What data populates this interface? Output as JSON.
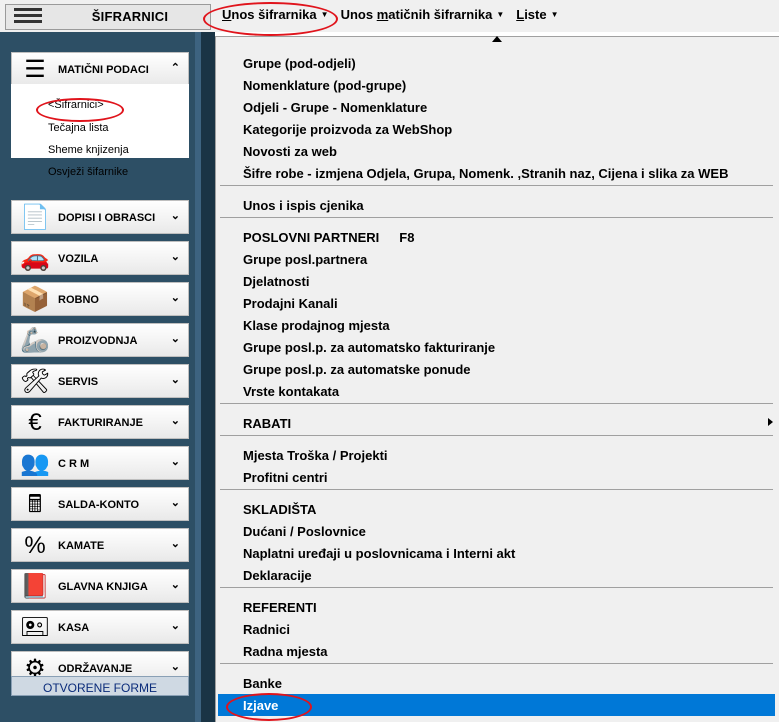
{
  "topbar": {
    "sifrarnici_label": "ŠIFRARNICI",
    "menus": [
      {
        "pre": "",
        "ul": "U",
        "post": "nos šifrarnika"
      },
      {
        "pre": "Unos ",
        "ul": "m",
        "post": "atičnih šifrarnika"
      },
      {
        "pre": "",
        "ul": "L",
        "post": "iste"
      }
    ]
  },
  "sidebar": {
    "categories": [
      {
        "label": "MATIČNI PODACI",
        "icon": "list-document-icon",
        "glyph": "☰",
        "chevron": "⌃"
      },
      {
        "label": "DOPISI I OBRASCI",
        "icon": "document-icon",
        "glyph": "📄",
        "chevron": "⌄"
      },
      {
        "label": "VOZILA",
        "icon": "car-icon",
        "glyph": "🚗",
        "chevron": "⌄"
      },
      {
        "label": "ROBNO",
        "icon": "boxes-icon",
        "glyph": "📦",
        "chevron": "⌄"
      },
      {
        "label": "PROIZVODNJA",
        "icon": "robot-arm-icon",
        "glyph": "🦾",
        "chevron": "⌄"
      },
      {
        "label": "SERVIS",
        "icon": "tools-icon",
        "glyph": "🛠",
        "chevron": "⌄"
      },
      {
        "label": "FAKTURIRANJE",
        "icon": "invoice-euro-icon",
        "glyph": "€",
        "chevron": "⌄"
      },
      {
        "label": "C R M",
        "icon": "people-icon",
        "glyph": "👥",
        "chevron": "⌄"
      },
      {
        "label": "SALDA-KONTO",
        "icon": "calculator-icon",
        "glyph": "🖩",
        "chevron": "⌄"
      },
      {
        "label": "KAMATE",
        "icon": "percent-icon",
        "glyph": "%",
        "chevron": "⌄"
      },
      {
        "label": "GLAVNA KNJIGA",
        "icon": "book-icon",
        "glyph": "📕",
        "chevron": "⌄"
      },
      {
        "label": "KASA",
        "icon": "cash-register-icon",
        "glyph": "🖭",
        "chevron": "⌄"
      },
      {
        "label": "ODRŽAVANJE",
        "icon": "gears-icon",
        "glyph": "⚙",
        "chevron": "⌄"
      }
    ],
    "subitems": [
      "<Šifrarnici>",
      "Tečajna lista",
      "Sheme knjizenja",
      "Osvježi šifarnike"
    ],
    "otvorene_forme": "OTVORENE FORME"
  },
  "dropdown": {
    "items": [
      {
        "label": "Grupe (pod-odjeli)"
      },
      {
        "label": "Nomenklature (pod-grupe)"
      },
      {
        "label": "Odjeli - Grupe - Nomenklature"
      },
      {
        "label": "Kategorije proizvoda za WebShop"
      },
      {
        "label": "Novosti za web"
      },
      {
        "label": "Šifre robe - izmjena Odjela, Grupa, Nomenk. ,Stranih naz, Cijena i slika za WEB"
      },
      {
        "label": "Unos i ispis cjenika"
      },
      {
        "label": "POSLOVNI PARTNERI",
        "shortcut": "F8"
      },
      {
        "label": "Grupe posl.partnera"
      },
      {
        "label": "Djelatnosti"
      },
      {
        "label": "Prodajni Kanali"
      },
      {
        "label": "Klase prodajnog mjesta"
      },
      {
        "label": "Grupe posl.p. za automatsko fakturiranje"
      },
      {
        "label": "Grupe posl.p. za automatske ponude"
      },
      {
        "label": "Vrste kontakata"
      },
      {
        "label": "RABATI"
      },
      {
        "label": "Mjesta Troška / Projekti"
      },
      {
        "label": "Profitni centri"
      },
      {
        "label": "SKLADIŠTA"
      },
      {
        "label": "Dućani / Poslovnice"
      },
      {
        "label": "Naplatni uređaji u poslovnicama i Interni akt"
      },
      {
        "label": "Deklaracije"
      },
      {
        "label": "REFERENTI"
      },
      {
        "label": "Radnici"
      },
      {
        "label": "Radna mjesta"
      },
      {
        "label": "Banke"
      },
      {
        "label": "Izjave"
      }
    ],
    "selected_index": 26,
    "submenu_index": 15
  },
  "colors": {
    "panel": "#2d4f65",
    "selection": "#0078d7",
    "annotation": "#e0141c"
  }
}
